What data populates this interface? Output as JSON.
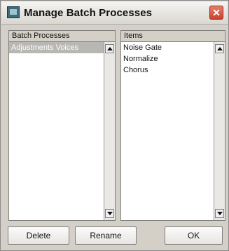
{
  "window": {
    "title": "Manage Batch Processes",
    "close_symbol": "✕"
  },
  "left_panel": {
    "header": "Batch Processes",
    "items": [
      "Adjustments Voices"
    ],
    "selected_index": 0
  },
  "right_panel": {
    "header": "Items",
    "items": [
      "Noise Gate",
      "Normalize",
      "Chorus"
    ]
  },
  "buttons": {
    "delete": "Delete",
    "rename": "Rename",
    "ok": "OK"
  },
  "icons": {
    "app": "app-window-icon",
    "close": "close-icon",
    "scroll_up": "scroll-up-arrow-icon",
    "scroll_down": "scroll-down-arrow-icon"
  },
  "colors": {
    "background": "#d4d0c8",
    "list_background": "#ffffff",
    "selection": "#b9b7b4",
    "close_button": "#c9432d"
  }
}
